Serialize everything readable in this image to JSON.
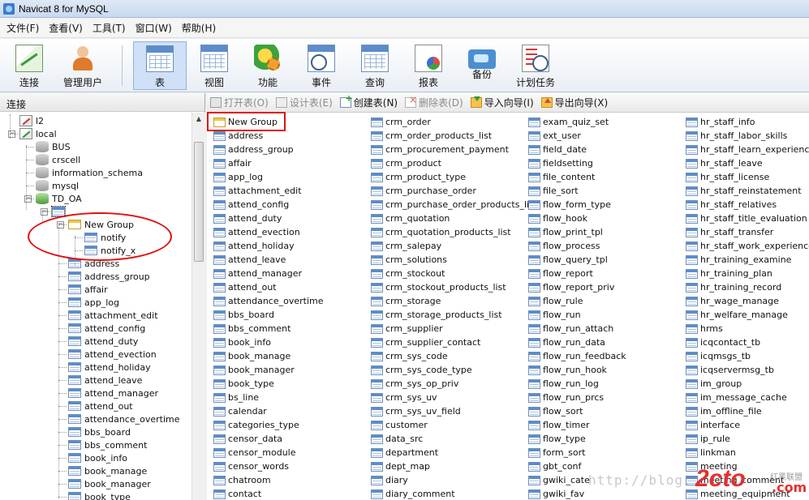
{
  "window": {
    "title": "Navicat 8 for MySQL"
  },
  "menu": [
    "文件(F)",
    "查看(V)",
    "工具(T)",
    "窗口(W)",
    "帮助(H)"
  ],
  "toolbar": [
    {
      "label": "连接",
      "icon": "connection-icon"
    },
    {
      "label": "管理用户",
      "icon": "user-icon"
    },
    {
      "label": "表",
      "icon": "table-icon",
      "active": true
    },
    {
      "label": "视图",
      "icon": "view-icon"
    },
    {
      "label": "功能",
      "icon": "function-icon"
    },
    {
      "label": "事件",
      "icon": "event-icon"
    },
    {
      "label": "查询",
      "icon": "query-icon"
    },
    {
      "label": "报表",
      "icon": "report-icon"
    },
    {
      "label": "备份",
      "icon": "backup-icon"
    },
    {
      "label": "计划任务",
      "icon": "schedule-icon"
    }
  ],
  "left_panel": {
    "header": "连接",
    "tree": [
      {
        "label": "l2",
        "icon": "connection-red"
      },
      {
        "label": "local",
        "icon": "connection-green"
      },
      {
        "label": "BUS",
        "icon": "database"
      },
      {
        "label": "crscell",
        "icon": "database"
      },
      {
        "label": "information_schema",
        "icon": "database"
      },
      {
        "label": "mysql",
        "icon": "database"
      },
      {
        "label": "TD_OA",
        "icon": "database-open"
      },
      {
        "label": "",
        "icon": "tables-node"
      },
      {
        "label": "New Group",
        "icon": "folder"
      },
      {
        "label": "notify",
        "icon": "table"
      },
      {
        "label": "notify_x",
        "icon": "table"
      },
      {
        "label": "address",
        "icon": "table"
      },
      {
        "label": "address_group",
        "icon": "table"
      },
      {
        "label": "affair",
        "icon": "table"
      },
      {
        "label": "app_log",
        "icon": "table"
      },
      {
        "label": "attachment_edit",
        "icon": "table"
      },
      {
        "label": "attend_config",
        "icon": "table"
      },
      {
        "label": "attend_duty",
        "icon": "table"
      },
      {
        "label": "attend_evection",
        "icon": "table"
      },
      {
        "label": "attend_holiday",
        "icon": "table"
      },
      {
        "label": "attend_leave",
        "icon": "table"
      },
      {
        "label": "attend_manager",
        "icon": "table"
      },
      {
        "label": "attend_out",
        "icon": "table"
      },
      {
        "label": "attendance_overtime",
        "icon": "table"
      },
      {
        "label": "bbs_board",
        "icon": "table"
      },
      {
        "label": "bbs_comment",
        "icon": "table"
      },
      {
        "label": "book_info",
        "icon": "table"
      },
      {
        "label": "book_manage",
        "icon": "table"
      },
      {
        "label": "book_manager",
        "icon": "table"
      },
      {
        "label": "book_type",
        "icon": "table"
      }
    ]
  },
  "object_toolbar": [
    {
      "label": "打开表(O)",
      "enabled": false,
      "icon": "open-table-icon"
    },
    {
      "label": "设计表(E)",
      "enabled": false,
      "icon": "design-table-icon"
    },
    {
      "label": "创建表(N)",
      "enabled": true,
      "icon": "new-table-icon"
    },
    {
      "label": "删除表(D)",
      "enabled": false,
      "icon": "delete-table-icon"
    },
    {
      "label": "导入向导(I)",
      "enabled": true,
      "icon": "import-wizard-icon"
    },
    {
      "label": "导出向导(X)",
      "enabled": true,
      "icon": "export-wizard-icon"
    }
  ],
  "objects": {
    "columns": [
      [
        "New Group",
        "address",
        "address_group",
        "affair",
        "app_log",
        "attachment_edit",
        "attend_config",
        "attend_duty",
        "attend_evection",
        "attend_holiday",
        "attend_leave",
        "attend_manager",
        "attend_out",
        "attendance_overtime",
        "bbs_board",
        "bbs_comment",
        "book_info",
        "book_manage",
        "book_manager",
        "book_type",
        "bs_line",
        "calendar",
        "categories_type",
        "censor_data",
        "censor_module",
        "censor_words",
        "chatroom",
        "contact"
      ],
      [
        "crm_order",
        "crm_order_products_list",
        "crm_procurement_payment",
        "crm_product",
        "crm_product_type",
        "crm_purchase_order",
        "crm_purchase_order_products_list",
        "crm_quotation",
        "crm_quotation_products_list",
        "crm_salepay",
        "crm_solutions",
        "crm_stockout",
        "crm_stockout_products_list",
        "crm_storage",
        "crm_storage_products_list",
        "crm_supplier",
        "crm_supplier_contact",
        "crm_sys_code",
        "crm_sys_code_type",
        "crm_sys_op_priv",
        "crm_sys_uv",
        "crm_sys_uv_field",
        "customer",
        "data_src",
        "department",
        "dept_map",
        "diary",
        "diary_comment"
      ],
      [
        "exam_quiz_set",
        "ext_user",
        "field_date",
        "fieldsetting",
        "file_content",
        "file_sort",
        "flow_form_type",
        "flow_hook",
        "flow_print_tpl",
        "flow_process",
        "flow_query_tpl",
        "flow_report",
        "flow_report_priv",
        "flow_rule",
        "flow_run",
        "flow_run_attach",
        "flow_run_data",
        "flow_run_feedback",
        "flow_run_hook",
        "flow_run_log",
        "flow_run_prcs",
        "flow_sort",
        "flow_timer",
        "flow_type",
        "form_sort",
        "gbt_conf",
        "gwiki_cate",
        "gwiki_fav"
      ],
      [
        "hr_staff_info",
        "hr_staff_labor_skills",
        "hr_staff_learn_experience",
        "hr_staff_leave",
        "hr_staff_license",
        "hr_staff_reinstatement",
        "hr_staff_relatives",
        "hr_staff_title_evaluation",
        "hr_staff_transfer",
        "hr_staff_work_experience",
        "hr_training_examine",
        "hr_training_plan",
        "hr_training_record",
        "hr_wage_manage",
        "hr_welfare_manage",
        "hrms",
        "icqcontact_tb",
        "icqmsgs_tb",
        "icqservermsg_tb",
        "im_group",
        "im_message_cache",
        "im_offline_file",
        "interface",
        "ip_rule",
        "linkman",
        "meeting",
        "meeting_comment",
        "meeting_equipment"
      ]
    ]
  },
  "watermark": {
    "url": "http://blog.",
    "logo": "2cto",
    "logo_small": "红黑联盟",
    "logo_sub": ".com"
  },
  "colors": {
    "highlight": "#e01010",
    "selection": "#cfe0f7"
  }
}
